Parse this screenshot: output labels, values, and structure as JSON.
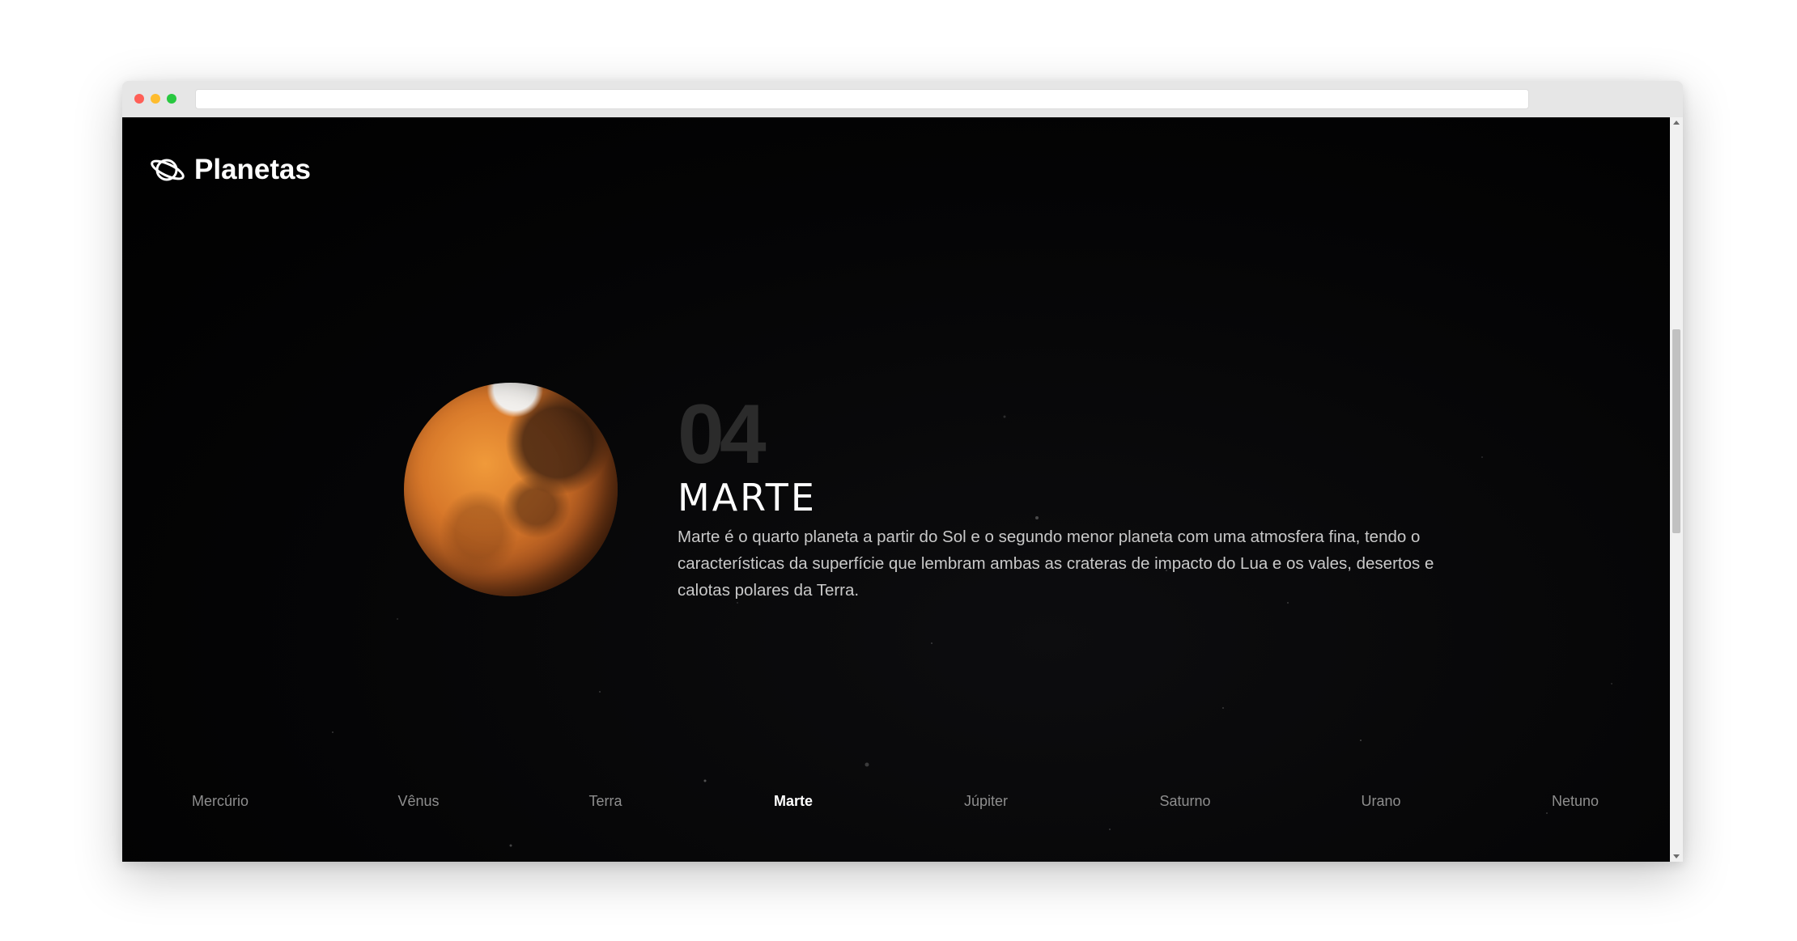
{
  "brand": {
    "title": "Planetas",
    "icon": "planet-ring-icon"
  },
  "planet": {
    "number": "04",
    "name": "MARTE",
    "description": "Marte é o quarto planeta a partir do Sol e o segundo menor planeta com uma atmosfera fina, tendo o características da superfície que lembram ambas as crateras de impacto do Lua e os vales, desertos e calotas polares da Terra."
  },
  "nav": {
    "items": [
      {
        "label": "Mercúrio"
      },
      {
        "label": "Vênus"
      },
      {
        "label": "Terra"
      },
      {
        "label": "Marte",
        "active": true
      },
      {
        "label": "Júpiter"
      },
      {
        "label": "Saturno"
      },
      {
        "label": "Urano"
      },
      {
        "label": "Netuno"
      }
    ]
  },
  "colors": {
    "background": "#000000",
    "text_primary": "#ffffff",
    "text_secondary": "#c9c9c9",
    "nav_inactive": "#8e8e8e",
    "number": "#2b2b2b"
  }
}
